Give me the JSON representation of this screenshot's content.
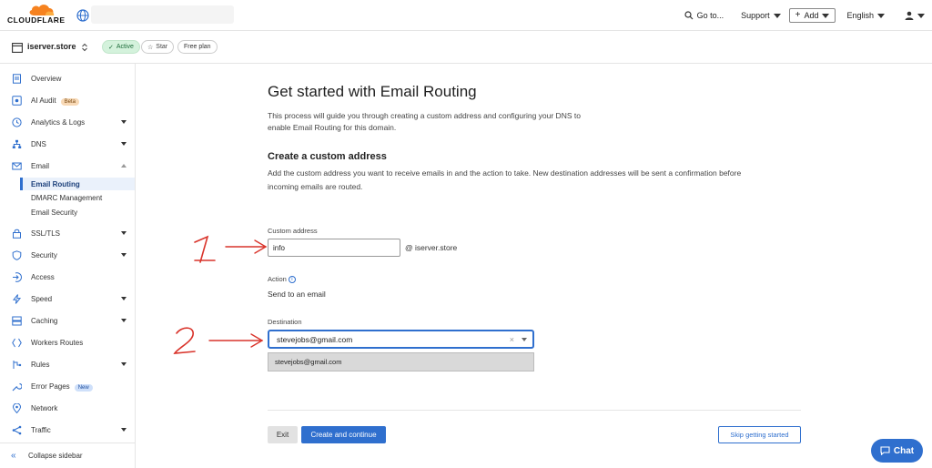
{
  "topbar": {
    "logo_text": "CLOUDFLARE",
    "goto_label": "Go to...",
    "support_label": "Support",
    "add_label": "Add",
    "language_label": "English"
  },
  "zone": {
    "name": "iserver.store",
    "status": "Active",
    "star_label": "Star",
    "plan": "Free plan"
  },
  "sidebar": {
    "items": [
      {
        "label": "Overview"
      },
      {
        "label": "AI Audit",
        "badge": "Beta"
      },
      {
        "label": "Analytics & Logs"
      },
      {
        "label": "DNS"
      },
      {
        "label": "Email"
      },
      {
        "label": "SSL/TLS"
      },
      {
        "label": "Security"
      },
      {
        "label": "Access"
      },
      {
        "label": "Speed"
      },
      {
        "label": "Caching"
      },
      {
        "label": "Workers Routes"
      },
      {
        "label": "Rules"
      },
      {
        "label": "Error Pages",
        "badge": "New"
      },
      {
        "label": "Network"
      },
      {
        "label": "Traffic"
      }
    ],
    "email_sub": [
      "Email Routing",
      "DMARC Management",
      "Email Security"
    ],
    "collapse_label": "Collapse sidebar"
  },
  "main": {
    "title": "Get started with Email Routing",
    "intro_line1": "This process will guide you through creating a custom address and configuring your DNS to",
    "intro_line2": "enable Email Routing for this domain.",
    "section_title": "Create a custom address",
    "section_desc_line1": "Add the custom address you want to receive emails in and the action to take. New destination addresses will be sent a confirmation before",
    "section_desc_line2": "incoming emails are routed.",
    "custom_address_label": "Custom address",
    "custom_address_value": "info",
    "domain_suffix": "@  iserver.store",
    "action_label": "Action",
    "action_value": "Send to an email",
    "destination_label": "Destination",
    "destination_value": "stevejobs@gmail.com",
    "dropdown_option": "stevejobs@gmail.com",
    "exit_label": "Exit",
    "create_label": "Create and continue",
    "skip_label": "Skip getting started"
  },
  "chat_label": "Chat",
  "colors": {
    "accent": "#2f6fce",
    "brand_orange": "#f6821f",
    "annotation_red": "#d9342b"
  }
}
